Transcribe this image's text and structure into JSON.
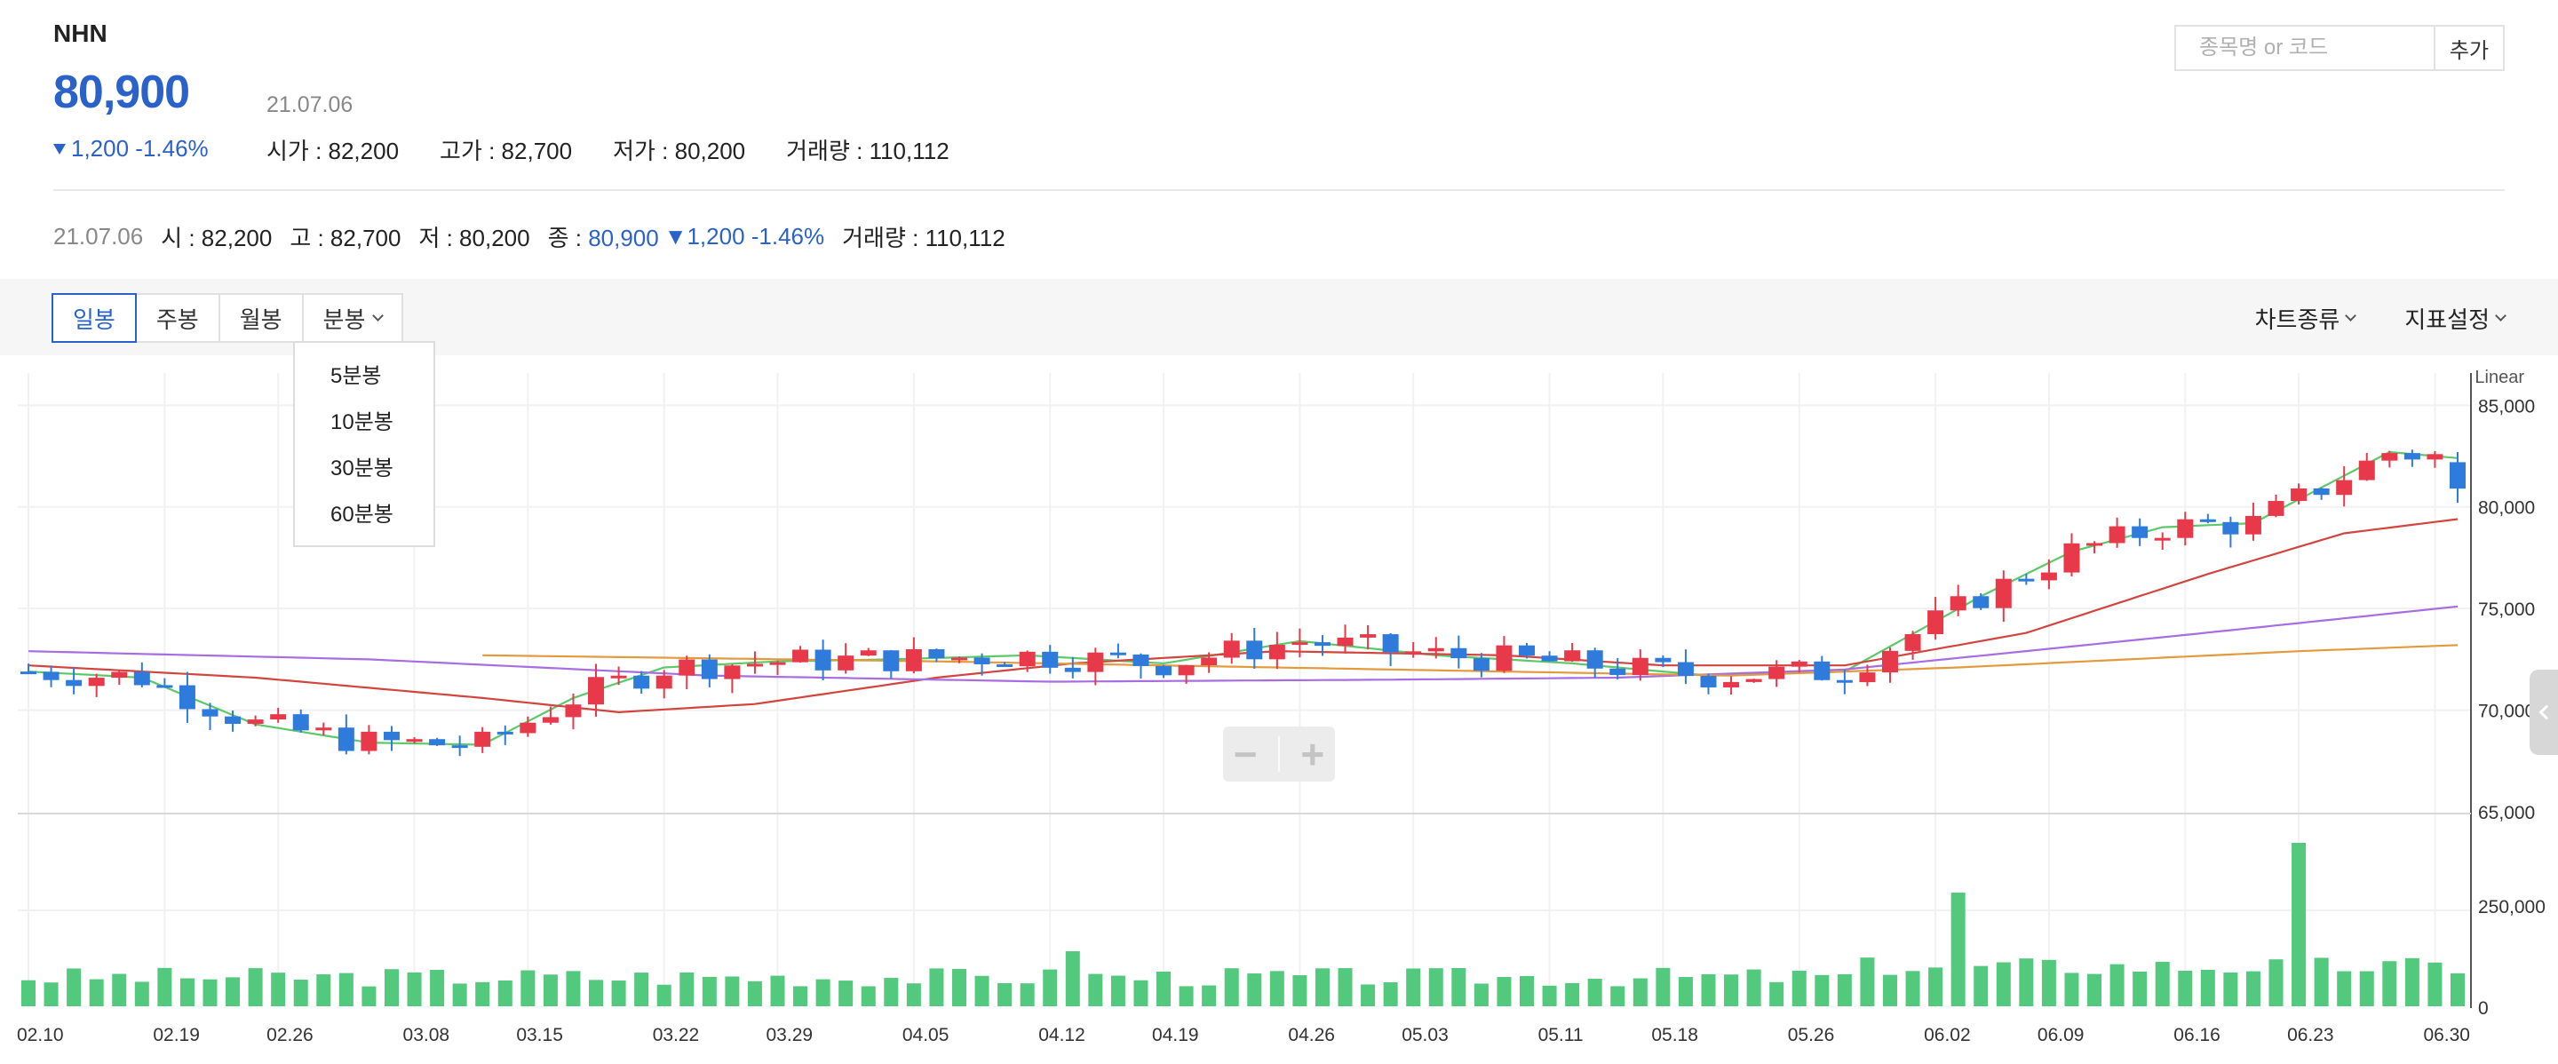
{
  "stock": {
    "name": "NHN",
    "price": "80,900",
    "change": "1,200 -1.46%",
    "date": "21.07.06",
    "stats": [
      "시가 : 82,200",
      "고가 : 82,700",
      "저가 : 80,200",
      "거래량 : 110,112"
    ]
  },
  "search": {
    "placeholder": "종목명 or 코드",
    "button": "추가"
  },
  "summary": {
    "date": "21.07.06",
    "open": "시 : 82,200",
    "high": "고 : 82,700",
    "low": "저 : 80,200",
    "close_label": "종 :",
    "close": "80,900",
    "change": "▼1,200 -1.46%",
    "volume": "거래량 : 110,112"
  },
  "tabs": [
    "일봉",
    "주봉",
    "월봉",
    "분봉"
  ],
  "active_tab": "일봉",
  "right_menu": [
    "차트종류",
    "지표설정"
  ],
  "minute_menu": [
    "5분봉",
    "10분봉",
    "30분봉",
    "60분봉"
  ],
  "colors": {
    "up": "#e8394a",
    "down": "#2e7bdc",
    "volume": "#52c97d",
    "ma5": "#5cc86a",
    "ma20": "#d2453f",
    "ma60": "#a86de0",
    "ma120": "#e39a3d",
    "accent": "#2a62c9"
  },
  "chart_data": {
    "type": "candlestick",
    "scale_label": "Linear",
    "price_ticks": [
      "85,000",
      "80,000",
      "75,000",
      "70,000",
      "65,000"
    ],
    "ylim": [
      65000,
      86500
    ],
    "volume_ticks": [
      "250,000",
      "0"
    ],
    "x_ticks": [
      "02.10",
      "02.19",
      "02.26",
      "03.08",
      "03.15",
      "03.22",
      "03.29",
      "04.05",
      "04.12",
      "04.19",
      "04.26",
      "05.03",
      "05.11",
      "05.18",
      "05.26",
      "06.02",
      "06.09",
      "06.16",
      "06.23",
      "06.30"
    ],
    "ma_series": [
      {
        "key": "ma5",
        "color": "#5cc86a",
        "values": [
          [
            0,
            71900
          ],
          [
            5,
            71600
          ],
          [
            10,
            69300
          ],
          [
            15,
            68400
          ],
          [
            20,
            68300
          ],
          [
            24,
            70600
          ],
          [
            28,
            72100
          ],
          [
            33,
            72400
          ],
          [
            38,
            72500
          ],
          [
            44,
            72700
          ],
          [
            50,
            72300
          ],
          [
            56,
            73400
          ],
          [
            62,
            72700
          ],
          [
            68,
            72300
          ],
          [
            74,
            71700
          ],
          [
            80,
            71900
          ],
          [
            86,
            75600
          ],
          [
            90,
            77800
          ],
          [
            94,
            79000
          ],
          [
            98,
            79200
          ],
          [
            104,
            82700
          ],
          [
            107,
            82400
          ]
        ]
      },
      {
        "key": "ma20",
        "color": "#d2453f",
        "values": [
          [
            0,
            72200
          ],
          [
            10,
            71600
          ],
          [
            20,
            70600
          ],
          [
            26,
            69900
          ],
          [
            32,
            70300
          ],
          [
            40,
            71600
          ],
          [
            46,
            72300
          ],
          [
            55,
            72900
          ],
          [
            65,
            72700
          ],
          [
            72,
            72200
          ],
          [
            80,
            72200
          ],
          [
            88,
            73800
          ],
          [
            96,
            76700
          ],
          [
            102,
            78700
          ],
          [
            107,
            79400
          ]
        ]
      },
      {
        "key": "ma60",
        "color": "#a86de0",
        "values": [
          [
            0,
            72900
          ],
          [
            15,
            72500
          ],
          [
            30,
            71700
          ],
          [
            45,
            71400
          ],
          [
            60,
            71500
          ],
          [
            70,
            71600
          ],
          [
            80,
            72000
          ],
          [
            95,
            73700
          ],
          [
            107,
            75100
          ]
        ]
      },
      {
        "key": "ma120",
        "color": "#e39a3d",
        "values": [
          [
            20,
            72700
          ],
          [
            40,
            72400
          ],
          [
            60,
            72000
          ],
          [
            75,
            71700
          ],
          [
            85,
            72100
          ],
          [
            100,
            72900
          ],
          [
            107,
            73200
          ]
        ]
      }
    ]
  }
}
